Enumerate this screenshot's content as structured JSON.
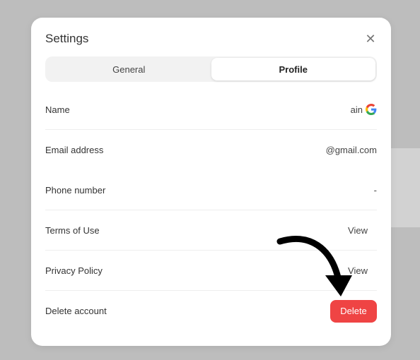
{
  "dialog": {
    "title": "Settings",
    "close_icon": "close-icon"
  },
  "tabs": [
    {
      "label": "General",
      "active": false
    },
    {
      "label": "Profile",
      "active": true
    }
  ],
  "rows": [
    {
      "label": "Name",
      "value": "ain",
      "icon": "google-icon"
    },
    {
      "label": "Email address",
      "value": "@gmail.com"
    },
    {
      "label": "Phone number",
      "value": "-"
    },
    {
      "label": "Terms of Use",
      "action": "View"
    },
    {
      "label": "Privacy Policy",
      "action": "View"
    },
    {
      "label": "Delete account",
      "action": "Delete"
    }
  ],
  "colors": {
    "delete_button": "#ef4444",
    "backdrop": "#bdbdbd"
  },
  "annotation": {
    "icon": "arrow-pointer-icon"
  }
}
